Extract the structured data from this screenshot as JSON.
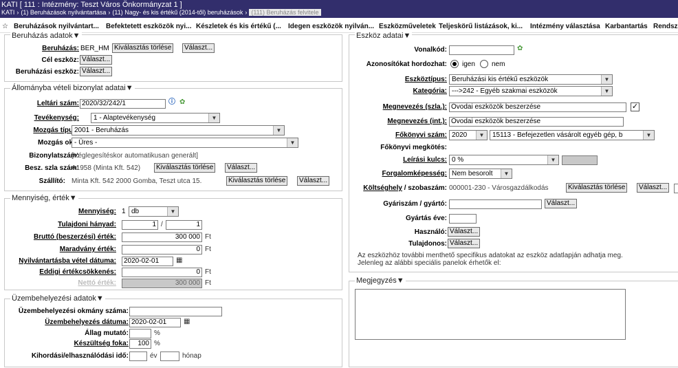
{
  "header": {
    "title": "KATI [ 111 : Intézmény: Teszt Város Önkormányzat 1 ]",
    "crumb1": "KATI",
    "crumb2": "(1) Beruházások nyilvántartása",
    "crumb3": "(11) Nagy- és kis értékű (2014-től) beruházások",
    "crumb4": "(111) Beruházás felvitele"
  },
  "menu": {
    "star": "☆",
    "items": [
      "Beruházások nyilvántart...",
      "Befektetett eszközök nyi...",
      "Készletek és kis értékű (...",
      "Idegen eszközök nyilván...",
      "Eszközműveletek",
      "Teljeskörű listázások, ki...",
      "Intézmény választása",
      "Karbantartás",
      "Rendszer"
    ]
  },
  "common": {
    "valassz": "Választ...",
    "torles": "Kiválasztás törlése",
    "ft": "Ft",
    "pct": "%",
    "slash": "/",
    "ev": "év",
    "honap": "hónap"
  },
  "beruhazas": {
    "legend": "Beruházás adatok",
    "beruhazas_label": "Beruházás:",
    "beruhazas_value": "BER_HM",
    "cel_label": "Cél eszköz:",
    "beruh_eszkoz_label": "Beruházási eszköz:"
  },
  "allomany": {
    "legend": "Állományba vételi bizonylat adatai",
    "leltari_label": "Leltári szám:",
    "leltari_value": "2020/32/242/1",
    "tevekenyseg_label": "Tevékenység:",
    "tevekenyseg_value": "1 - Alaptevékenység",
    "mozgas_label": "Mozgás típus:",
    "mozgas_value": "2001 - Beruházás",
    "mozgas_oka_label": "Mozgás oka:",
    "mozgas_oka_value": "- Üres -",
    "bizonylat_label": "Bizonylatszám:",
    "bizonylat_value": "[Véglegesítéskor automatikusan generált]",
    "besz_label": "Besz. szla szám:",
    "besz_value": "A1958 (Minta Kft. 542)",
    "szallito_label": "Szállító:",
    "szallito_value": "Minta Kft. 542 2000 Gomba, Teszt utca 15."
  },
  "mennyiseg": {
    "legend": "Mennyiség, érték",
    "mennyiseg_label": "Mennyiség:",
    "mennyiseg_value": "1",
    "mennyiseg_unit": "db",
    "tulajdoni_label": "Tulajdoni hányad:",
    "tulajdoni_a": "1",
    "tulajdoni_b": "1",
    "brutto_label": "Bruttó (beszerzési) érték:",
    "brutto_value": "300 000",
    "maradvany_label": "Maradvány érték:",
    "maradvany_value": "0",
    "nyilv_datum_label": "Nyilvántartásba vétel dátuma:",
    "nyilv_datum_value": "2020-02-01",
    "eddigi_label": "Eddigi értékcsökkenés:",
    "eddigi_value": "0",
    "netto_label": "Nettó érték:",
    "netto_value": "300 000"
  },
  "uzembe": {
    "legend": "Üzembehelyezési adatok",
    "okmany_label": "Üzembehelyezési okmány száma:",
    "datum_label": "Üzembehelyezés dátuma:",
    "datum_value": "2020-02-01",
    "allag_label": "Állag mutató:",
    "keszultseg_label": "Készültség foka:",
    "keszultseg_value": "100",
    "kihordasi_label": "Kihordási/elhasználódási idő:"
  },
  "eszkoz": {
    "legend": "Eszköz adatai",
    "vonalkod_label": "Vonalkód:",
    "azonosito_label": "Azonosítókat hordozhat:",
    "igen": "igen",
    "nem": "nem",
    "eszkoztipus_label": "Eszköztípus:",
    "eszkoztipus_value": "Beruházási kis értékű eszközök",
    "kategoria_label": "Kategória:",
    "kategoria_value": "--->242 - Egyéb szakmai eszközök",
    "megnev_szla_label": "Megnevezés (szla.):",
    "megnev_szla_value": "Óvodai eszközök beszerzése",
    "checkmark": "✓",
    "megnev_int_label": "Megnevezés (int.):",
    "megnev_int_value": "Óvodai eszközök beszerzése",
    "fokonyvi_label": "Főkönyvi szám:",
    "fokonyvi_year": "2020",
    "fokonyvi_value": "15113 - Befejezetlen vásárolt egyéb gép, b",
    "fokonyvi_megkotes_label": "Főkönyvi megkötés:",
    "leirasi_label": "Leírási kulcs:",
    "leirasi_value": "0 %",
    "forgalom_label": "Forgalomképesség:",
    "forgalom_value": "Nem besorolt",
    "koltseghely_label_a": "Költséghely",
    "koltseghely_label_b": " / szobaszám:",
    "koltseghely_value": "000001-230 - Városgazdálkodás",
    "gyariszam_label": "Gyáriszám / gyártó:",
    "gyartas_label": "Gyártás éve:",
    "hasznalo_label": "Használó:",
    "tulajdonos_label": "Tulajdonos:",
    "info1": "Az eszközhöz további menthető specifikus adatokat az eszköz adatlapján adhatja meg.",
    "info2": "Jelenleg az alábbi speciális panelok érhetők el:"
  },
  "megjegyzes": {
    "legend": "Megjegyzés"
  },
  "icons": {
    "refresh": "refresh-icon",
    "info": "info-icon",
    "calendar": "calendar-icon",
    "dropdown": "chevron-down-icon"
  },
  "colors": {
    "titlebar": "#322e6c",
    "button": "#e8e8e8",
    "disabled": "#c8c8c8"
  }
}
